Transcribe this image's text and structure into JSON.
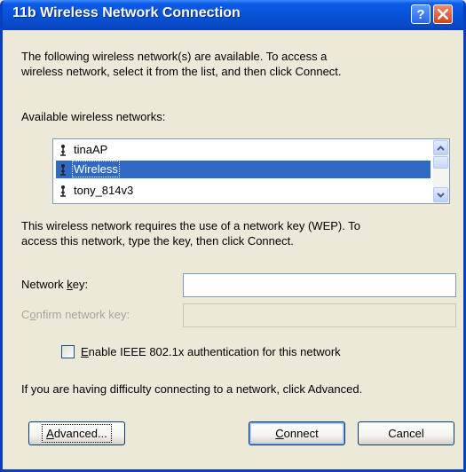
{
  "window": {
    "title": "11b Wireless Network Connection",
    "help_glyph": "?",
    "close_icon": "close-icon"
  },
  "intro": {
    "line1": "The following wireless network(s) are available. To access a",
    "line2": "wireless network, select it from the list, and then click Connect."
  },
  "networks": {
    "label": "Available wireless networks:",
    "items": [
      {
        "name": "tinaAP",
        "selected": false,
        "icon": "antenna-icon"
      },
      {
        "name": "Wireless",
        "selected": true,
        "icon": "antenna-icon"
      },
      {
        "name": "tony_814v3",
        "selected": false,
        "icon": "antenna-icon"
      }
    ]
  },
  "key_info": {
    "line1": "This wireless network requires the use of a network key (WEP). To",
    "line2": "access this network, type the key, then click Connect."
  },
  "fields": {
    "network_key_prefix": "Network ",
    "network_key_access": "k",
    "network_key_suffix": "ey:",
    "network_key_value": "",
    "confirm_prefix": "C",
    "confirm_access": "o",
    "confirm_suffix": "nfirm network key:",
    "confirm_value": ""
  },
  "checkbox": {
    "access": "E",
    "label_rest": "nable IEEE 802.1x authentication for this network",
    "checked": false
  },
  "advanced_hint": "If you are having difficulty connecting to a network, click Advanced.",
  "buttons": {
    "advanced_access": "A",
    "advanced_rest": "dvanced...",
    "connect_access": "C",
    "connect_rest": "onnect",
    "cancel": "Cancel"
  },
  "colors": {
    "titlebar": "#0652d6",
    "selection": "#316ac5",
    "dialog_bg": "#ece9d8"
  }
}
